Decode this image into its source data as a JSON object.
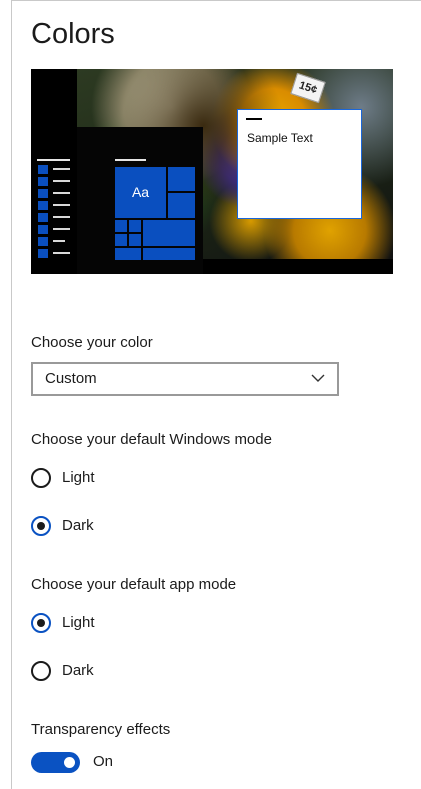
{
  "page": {
    "title": "Colors"
  },
  "preview": {
    "tile_label": "Aa",
    "sample_text": "Sample Text",
    "price_tag": "15¢",
    "accent_color": "#0a4fbf"
  },
  "color_choice": {
    "label": "Choose your color",
    "selected": "Custom"
  },
  "windows_mode": {
    "label": "Choose your default Windows mode",
    "options": [
      {
        "label": "Light",
        "checked": false
      },
      {
        "label": "Dark",
        "checked": true
      }
    ]
  },
  "app_mode": {
    "label": "Choose your default app mode",
    "options": [
      {
        "label": "Light",
        "checked": true
      },
      {
        "label": "Dark",
        "checked": false
      }
    ]
  },
  "transparency": {
    "label": "Transparency effects",
    "state": "On",
    "enabled": true
  },
  "icons": {
    "dropdown": "chevron-down-icon"
  }
}
